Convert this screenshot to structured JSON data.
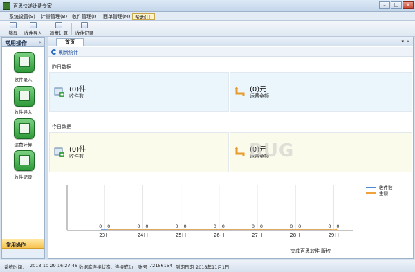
{
  "window": {
    "title": "百思快递计费专家",
    "min": "–",
    "max": "□",
    "close": "×"
  },
  "menu": [
    "系统设置(S)",
    "计量管理(B)",
    "收件管理(I)",
    "面单管理(M)",
    "帮助(H)"
  ],
  "toolbar": [
    "锁屏",
    "收件导入",
    "运费计算",
    "收件记录"
  ],
  "sidebar": {
    "title": "常用操作",
    "collapse": "«",
    "items": [
      "收件录入",
      "收件导入",
      "运费计算",
      "收件记录"
    ],
    "footer_active": "常用操作"
  },
  "main": {
    "tab": "首页",
    "refresh": "刷新统计",
    "yesterday": {
      "label": "昨日数据",
      "count_value": "(0)件",
      "count_label": "收件数",
      "fee_value": "(0)元",
      "fee_label": "运费金额"
    },
    "today": {
      "label": "今日数据",
      "count_value": "(0)件",
      "count_label": "收件数",
      "fee_value": "(0)元",
      "fee_label": "运费金额"
    },
    "footer_left": "文成百思软件",
    "footer_right": "版权"
  },
  "colors": {
    "series1": "#4a8bd6",
    "series2": "#f0a23a"
  },
  "chart_data": {
    "type": "line",
    "categories": [
      "23日",
      "24日",
      "25日",
      "26日",
      "27日",
      "28日",
      "29日"
    ],
    "series": [
      {
        "name": "收件数",
        "values": [
          0,
          0,
          0,
          0,
          0,
          0,
          0
        ]
      },
      {
        "name": "金额",
        "values": [
          0,
          0,
          0,
          0,
          0,
          0,
          0
        ]
      }
    ],
    "legend": "top-right"
  },
  "status": {
    "time_label": "系统时间：",
    "time": "2018-10-29 16:27:46",
    "db_label": "数据库连接状态：",
    "db": "连接成功",
    "acct_label": "账号",
    "acct": "72156154",
    "exp_label": "到期日期",
    "exp": "2018年11月1日"
  },
  "watermark": "BUG"
}
